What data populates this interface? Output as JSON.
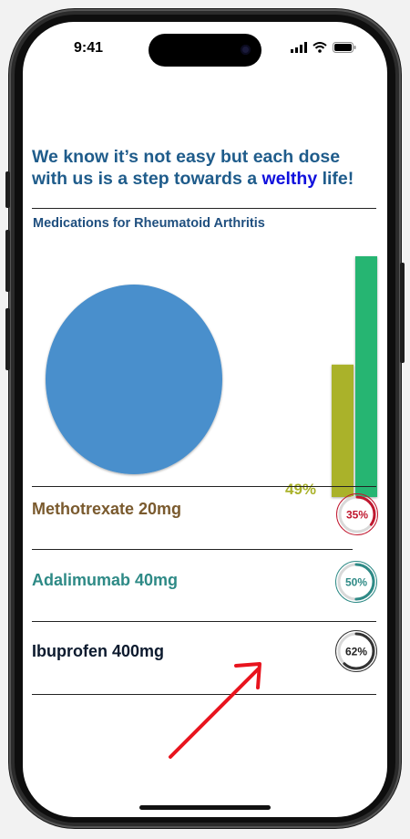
{
  "status": {
    "time": "9:41"
  },
  "headline": {
    "part1": "We know it’s not easy but each dose with us is a step towards a ",
    "highlight": "welthy",
    "part2": " life!"
  },
  "section_title": "Medications for Rheumatoid Arthritis",
  "chart_data": {
    "type": "bar",
    "value_label": "49%",
    "values": [
      0.55,
      1.0
    ],
    "colors": [
      "#aab22a",
      "#25b572"
    ]
  },
  "medications": [
    {
      "name": "Methotrexate 20mg",
      "percent": 35,
      "label": "35%",
      "name_color": "#7a5a2e",
      "ring_color": "#c0182f"
    },
    {
      "name": "Adalimumab 40mg",
      "percent": 50,
      "label": "50%",
      "name_color": "#2e8a86",
      "ring_color": "#2e8a86"
    },
    {
      "name": "Ibuprofen 400mg",
      "percent": 62,
      "label": "62%",
      "name_color": "#0c1a2e",
      "ring_color": "#333333"
    }
  ],
  "colors": {
    "circle": "#4a8fcc",
    "arrow": "#e8141e"
  }
}
